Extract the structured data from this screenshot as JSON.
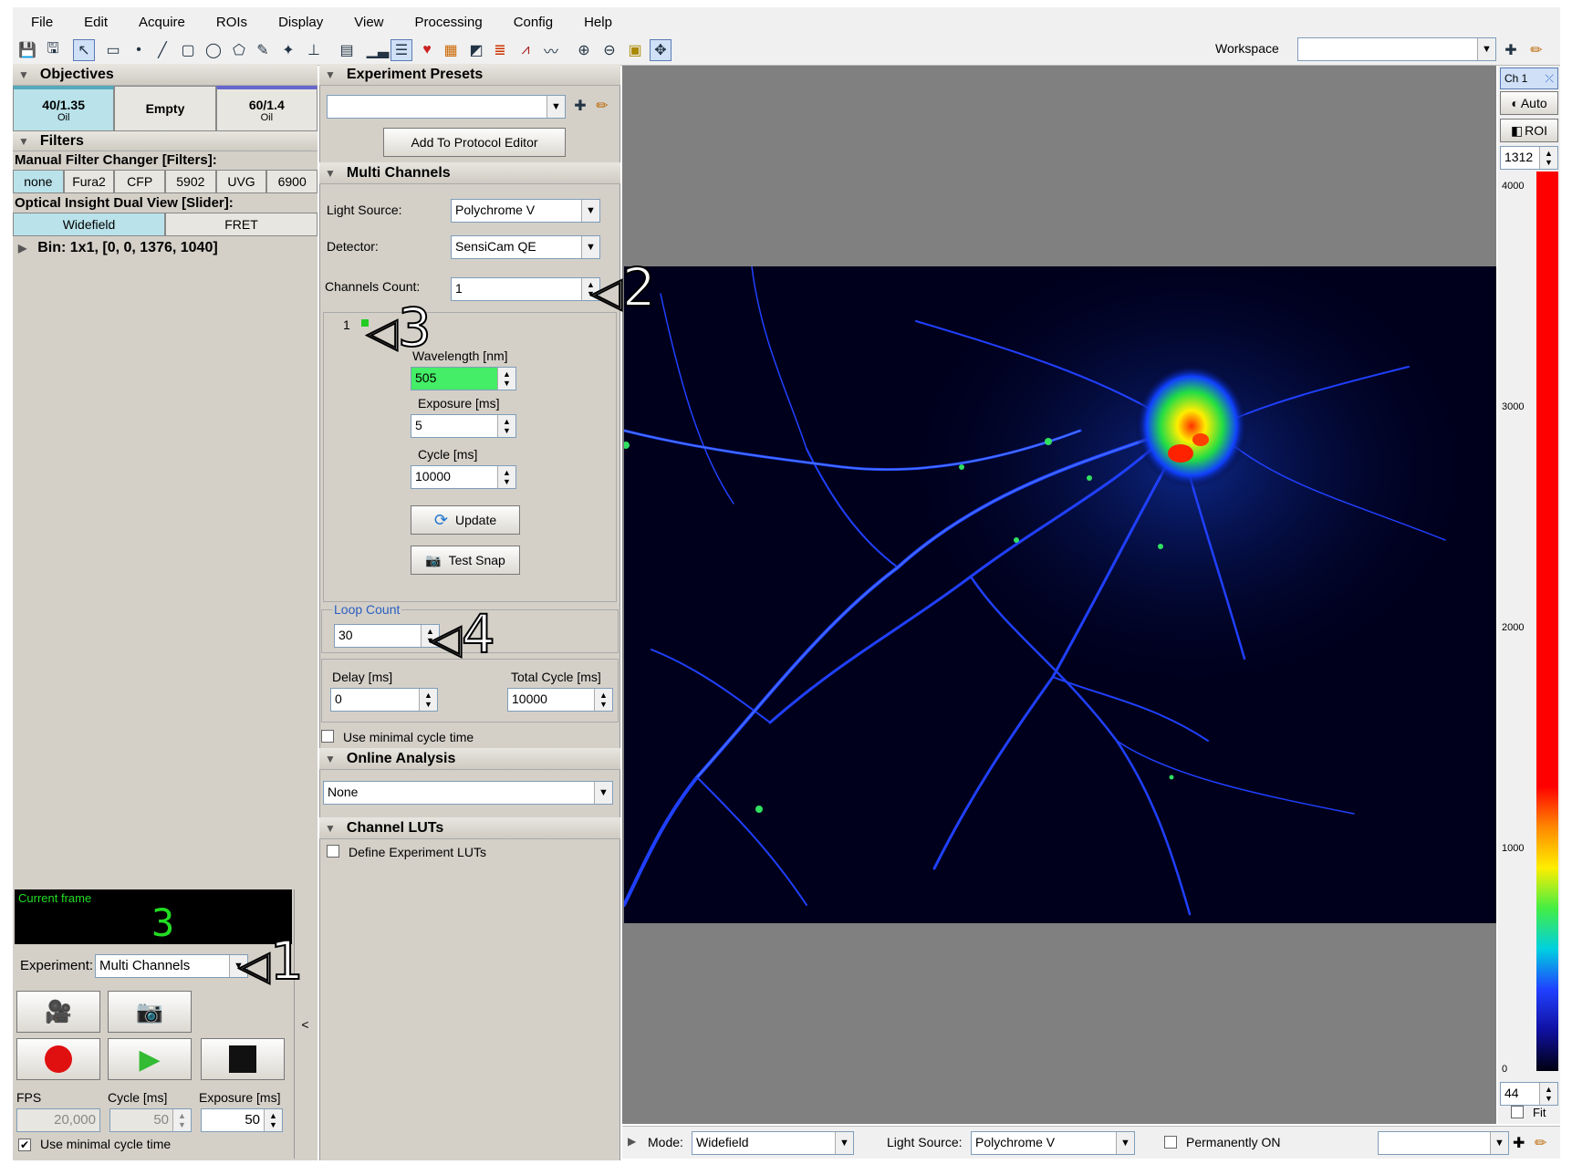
{
  "menu": [
    "File",
    "Edit",
    "Acquire",
    "ROIs",
    "Display",
    "View",
    "Processing",
    "Config",
    "Help"
  ],
  "workspace": {
    "label": "Workspace",
    "value": ""
  },
  "objectives": {
    "title": "Objectives",
    "items": [
      {
        "name": "40/1.35",
        "sub": "Oil",
        "active": true
      },
      {
        "name": "Empty",
        "sub": "",
        "active": false
      },
      {
        "name": "60/1.4",
        "sub": "Oil",
        "active": false
      }
    ]
  },
  "filters": {
    "title": "Filters",
    "changer_label": "Manual Filter Changer [Filters]:",
    "changer_items": [
      "none",
      "Fura2",
      "CFP",
      "5902",
      "UVG",
      "6900"
    ],
    "dualview_label": "Optical Insight Dual View [Slider]:",
    "dualview_items": [
      "Widefield",
      "FRET"
    ],
    "bin": "Bin: 1x1, [0, 0, 1376, 1040]"
  },
  "current_frame": {
    "label": "Current frame",
    "value": "3"
  },
  "experiment": {
    "label": "Experiment:",
    "value": "Multi Channels"
  },
  "stats": {
    "fps_label": "FPS",
    "fps": "20,000",
    "cycle_label": "Cycle [ms]",
    "cycle": "50",
    "exposure_label": "Exposure [ms]",
    "exposure": "50",
    "minimal_label": "Use minimal cycle time",
    "minimal_checked": true
  },
  "presets": {
    "title": "Experiment Presets",
    "value": "",
    "add_button": "Add To Protocol Editor"
  },
  "multi": {
    "title": "Multi Channels",
    "light_label": "Light Source:",
    "light_value": "Polychrome V",
    "detector_label": "Detector:",
    "detector_value": "SensiCam QE",
    "count_label": "Channels Count:",
    "count_value": "1",
    "channel_tab": "1",
    "wavelength_label": "Wavelength [nm]",
    "wavelength": "505",
    "exposure_label": "Exposure [ms]",
    "exposure": "5",
    "cycle_label": "Cycle [ms]",
    "cycle": "10000",
    "update": "Update",
    "testsnap": "Test Snap"
  },
  "loop": {
    "label": "Loop Count",
    "value": "30",
    "delay_label": "Delay [ms]",
    "delay": "0",
    "total_label": "Total Cycle [ms]",
    "total": "10000",
    "minimal_label": "Use minimal cycle time"
  },
  "online": {
    "title": "Online Analysis",
    "value": "None"
  },
  "luts": {
    "title": "Channel LUTs",
    "define_label": "Define Experiment LUTs"
  },
  "lut_panel": {
    "channel": "Ch 1",
    "auto": "Auto",
    "roi": "ROI",
    "max": "1312",
    "min": "44",
    "fit": "Fit",
    "ticks": [
      "4000",
      "3000",
      "2000",
      "1000",
      "0"
    ]
  },
  "statusbar": {
    "mode_label": "Mode:",
    "mode": "Widefield",
    "light_label": "Light Source:",
    "light": "Polychrome V",
    "perm_label": "Permanently ON"
  },
  "callouts": [
    "1",
    "2",
    "3",
    "4"
  ],
  "collapse": "<",
  "colors": {
    "panel": "#d4d0c8",
    "viewer": "#808080",
    "active_tab": "#b9e2ea",
    "wavelength_bg": "#44ee66",
    "lut_red": "#ff0000",
    "frame_text": "#22dd22"
  },
  "icons": [
    "save-icon",
    "save-as-icon",
    "pointer-icon",
    "ruler-icon",
    "point-icon",
    "line-icon",
    "rect-icon",
    "ellipse-icon",
    "polygon-icon",
    "freehand-icon",
    "wand-icon",
    "stamp-icon",
    "calc-icon",
    "histogram-icon",
    "lut-icon",
    "color-icon",
    "tiles-icon",
    "graph-icon",
    "list-icon",
    "chart-icon",
    "profile-icon",
    "zoom-in-icon",
    "zoom-out-icon",
    "zoom-1-icon",
    "fit-icon"
  ]
}
